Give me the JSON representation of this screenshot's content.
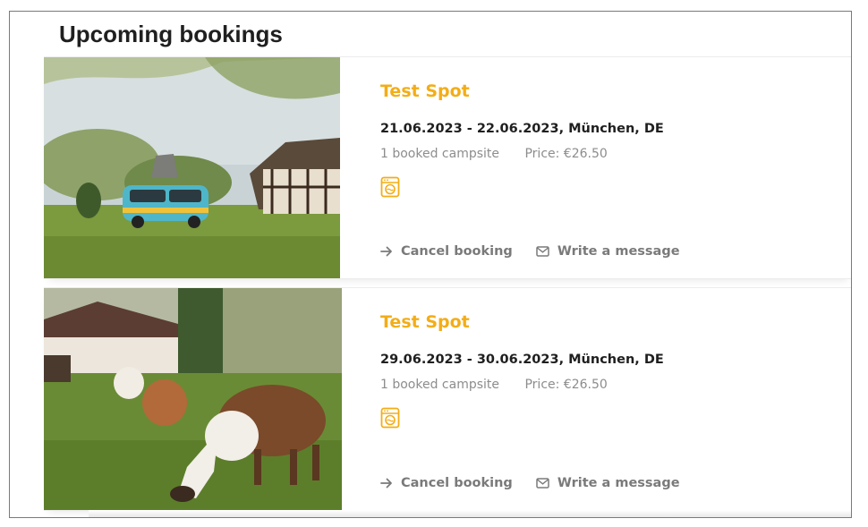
{
  "page": {
    "title": "Upcoming bookings"
  },
  "bookings": [
    {
      "spot_name": "Test Spot",
      "dates": "21.06.2023 - 22.06.2023, München, DE",
      "campsites": "1 booked campsite",
      "price": "Price: €26.50",
      "amenity_icon": "washing-machine-icon",
      "photo": "camper-van-half-timbered-house",
      "actions": {
        "cancel": "Cancel booking",
        "message": "Write a message"
      }
    },
    {
      "spot_name": "Test Spot",
      "dates": "29.06.2023 - 30.06.2023, München, DE",
      "campsites": "1 booked campsite",
      "price": "Price: €26.50",
      "amenity_icon": "washing-machine-icon",
      "photo": "alpacas-grazing",
      "actions": {
        "cancel": "Cancel booking",
        "message": "Write a message"
      }
    }
  ],
  "colors": {
    "accent": "#f3ad17",
    "text": "#1f1f1f",
    "muted": "#8d8d8d",
    "action": "#7a7a7a"
  }
}
